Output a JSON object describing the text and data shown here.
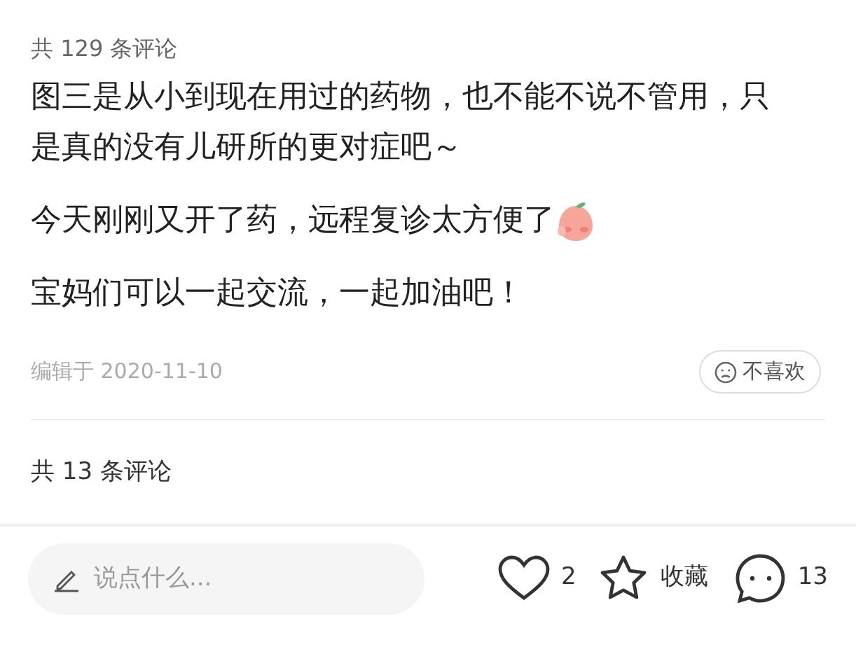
{
  "header": {
    "text": "共 129 条评论"
  },
  "paragraphs": [
    {
      "text": "图三是从小到现在用过的药物，也不能不说不管用，只是真的没有儿研所的更对症吧～",
      "emoji": false
    },
    {
      "text": "今天刚刚又开了药，远程复诊太方便了",
      "emoji": true
    },
    {
      "text": "宝妈们可以一起交流，一起加油吧！",
      "emoji": false
    }
  ],
  "edited": "编辑于 2020-11-10",
  "dislike_button": "不喜欢",
  "comment_count": "共 13 条评论",
  "bottom_bar": {
    "placeholder": "说点什么...",
    "likes": "2",
    "favorite": "收藏",
    "comments": "13"
  }
}
